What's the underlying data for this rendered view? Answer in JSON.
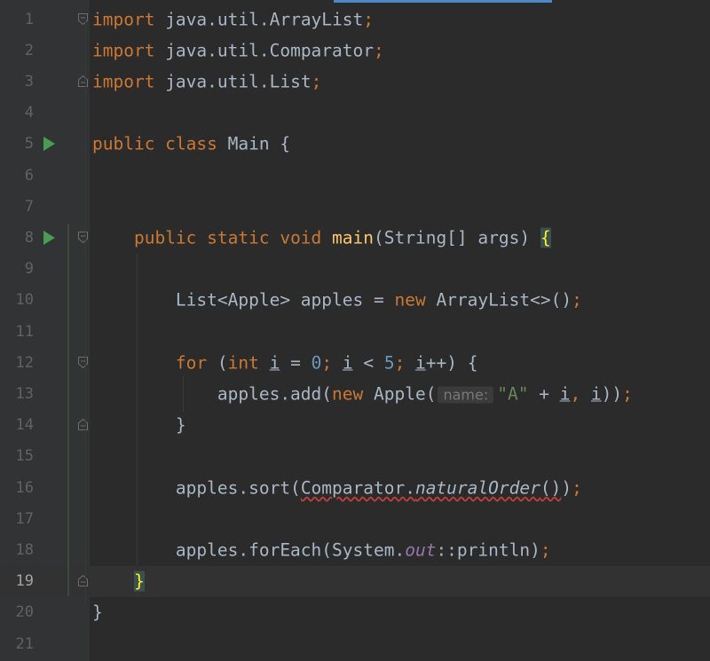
{
  "editor": {
    "lines": [
      {
        "n": "1",
        "parts": [
          [
            "kw",
            "import"
          ],
          [
            "p",
            " java.util.ArrayList"
          ],
          [
            "semi",
            ";"
          ]
        ]
      },
      {
        "n": "2",
        "parts": [
          [
            "kw",
            "import"
          ],
          [
            "p",
            " java.util.Comparator"
          ],
          [
            "semi",
            ";"
          ]
        ]
      },
      {
        "n": "3",
        "parts": [
          [
            "kw",
            "import"
          ],
          [
            "p",
            " java.util.List"
          ],
          [
            "semi",
            ";"
          ]
        ]
      },
      {
        "n": "4",
        "parts": []
      },
      {
        "n": "5",
        "parts": [
          [
            "kw",
            "public class "
          ],
          [
            "p",
            "Main {"
          ]
        ]
      },
      {
        "n": "6",
        "parts": []
      },
      {
        "n": "7",
        "parts": []
      },
      {
        "n": "8",
        "parts": [
          [
            "p",
            "    "
          ],
          [
            "kw",
            "public static void "
          ],
          [
            "fn",
            "main"
          ],
          [
            "p",
            "(String[] args) "
          ],
          [
            "brace",
            "{"
          ]
        ]
      },
      {
        "n": "9",
        "parts": []
      },
      {
        "n": "10",
        "parts": [
          [
            "p",
            "        List<Apple> apples = "
          ],
          [
            "kw",
            "new "
          ],
          [
            "p",
            "ArrayList<>()"
          ],
          [
            "semi",
            ";"
          ]
        ]
      },
      {
        "n": "11",
        "parts": []
      },
      {
        "n": "12",
        "parts": [
          [
            "p",
            "        "
          ],
          [
            "kw",
            "for "
          ],
          [
            "p",
            "("
          ],
          [
            "kw",
            "int "
          ],
          [
            "u",
            "i"
          ],
          [
            "p",
            " = "
          ],
          [
            "num",
            "0"
          ],
          [
            "semi",
            "; "
          ],
          [
            "u",
            "i"
          ],
          [
            "p",
            " < "
          ],
          [
            "num",
            "5"
          ],
          [
            "semi",
            "; "
          ],
          [
            "u",
            "i"
          ],
          [
            "p",
            "++) {"
          ]
        ]
      },
      {
        "n": "13",
        "parts": [
          [
            "p",
            "            apples.add("
          ],
          [
            "kw",
            "new "
          ],
          [
            "p",
            "Apple("
          ],
          [
            "hint",
            "name:"
          ],
          [
            "str",
            "\"A\""
          ],
          [
            "p",
            " + "
          ],
          [
            "u",
            "i"
          ],
          [
            "semi",
            ", "
          ],
          [
            "u",
            "i"
          ],
          [
            "p",
            "))"
          ],
          [
            "semi",
            ";"
          ]
        ]
      },
      {
        "n": "14",
        "parts": [
          [
            "p",
            "        }"
          ]
        ]
      },
      {
        "n": "15",
        "parts": []
      },
      {
        "n": "16",
        "parts": [
          [
            "p",
            "        apples.sort("
          ],
          [
            "sq",
            "Comparator."
          ],
          [
            "sqi",
            "naturalOrder"
          ],
          [
            "sq",
            "()"
          ],
          [
            "p",
            ")"
          ],
          [
            "semi",
            ";"
          ]
        ]
      },
      {
        "n": "17",
        "parts": []
      },
      {
        "n": "18",
        "parts": [
          [
            "p",
            "        apples.forEach(System."
          ],
          [
            "sf",
            "out"
          ],
          [
            "p",
            "::println)"
          ],
          [
            "semi",
            ";"
          ]
        ]
      },
      {
        "n": "19",
        "parts": [
          [
            "p",
            "    "
          ],
          [
            "brace",
            "}"
          ]
        ]
      },
      {
        "n": "20",
        "parts": [
          [
            "p",
            "}"
          ]
        ]
      },
      {
        "n": "21",
        "parts": []
      }
    ],
    "current_line": "19",
    "run_icons_on": [
      "5",
      "8"
    ],
    "fold_markers": {
      "1": "start",
      "3": "end",
      "8": "start",
      "12": "start",
      "14": "end",
      "19": "end"
    },
    "icons": {
      "run": "run-icon",
      "fold": "fold-icon"
    }
  }
}
